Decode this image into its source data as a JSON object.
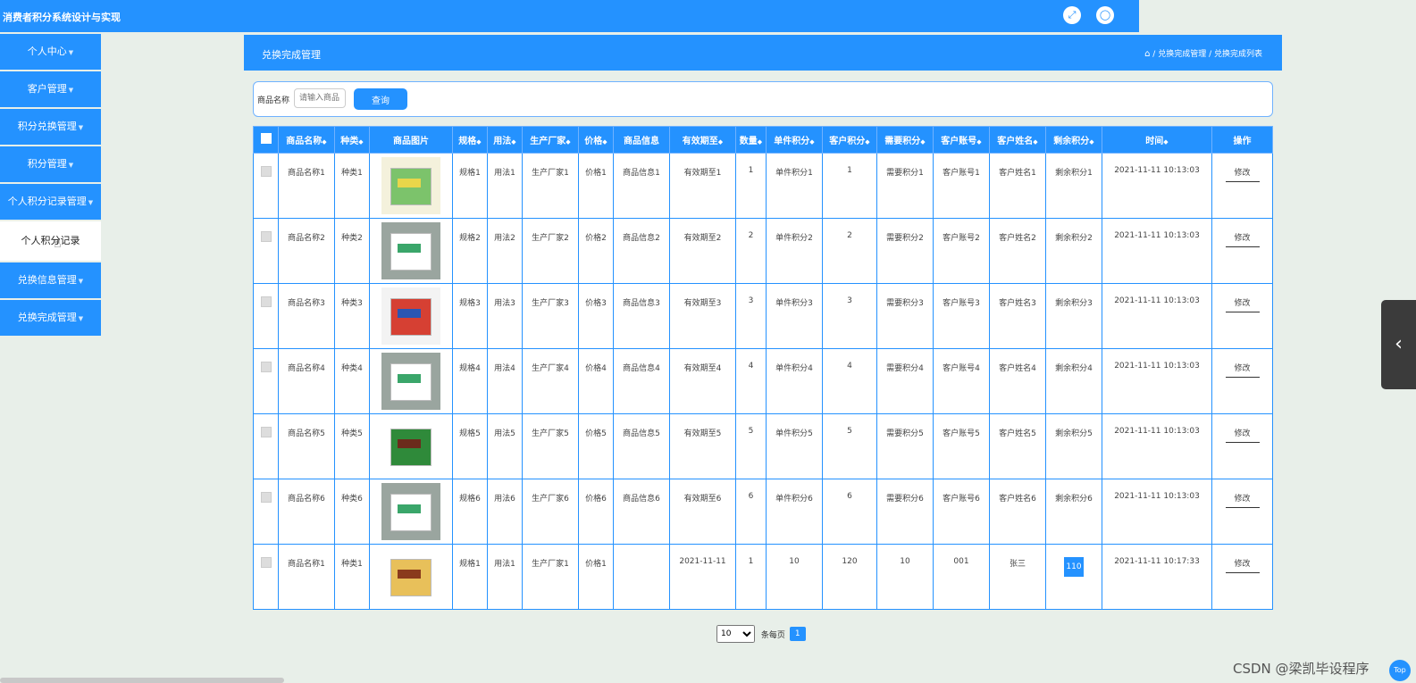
{
  "app": {
    "title": "消费者积分系统设计与实现"
  },
  "topbar": {
    "fullscreen_icon": "expand-icon",
    "user_icon": "user-icon"
  },
  "sidebar": {
    "items": [
      {
        "label": "个人中心",
        "active": false
      },
      {
        "label": "客户管理",
        "active": false
      },
      {
        "label": "积分兑换管理",
        "active": false
      },
      {
        "label": "积分管理",
        "active": false
      },
      {
        "label": "个人积分记录管理",
        "active": false
      },
      {
        "label": "个人积分记录",
        "active": true,
        "sub": true
      },
      {
        "label": "兑换信息管理",
        "active": false
      },
      {
        "label": "兑换完成管理",
        "active": false
      }
    ]
  },
  "header": {
    "title": "兑换完成管理",
    "breadcrumb": [
      "兑换完成管理",
      "兑换完成列表"
    ]
  },
  "search": {
    "label": "商品名称",
    "placeholder": "请输入商品",
    "button": "查询"
  },
  "table": {
    "columns": [
      "商品名称",
      "种类",
      "商品图片",
      "规格",
      "用法",
      "生产厂家",
      "价格",
      "商品信息",
      "有效期至",
      "数量",
      "单件积分",
      "客户积分",
      "需要积分",
      "客户账号",
      "客户姓名",
      "剩余积分",
      "时间",
      "操作"
    ],
    "rows": [
      {
        "name": "商品名称1",
        "kind": "种类1",
        "spec": "规格1",
        "usage": "用法1",
        "maker": "生产厂家1",
        "price": "价格1",
        "info": "商品信息1",
        "expiry": "有效期至1",
        "qty": "1",
        "unit_points": "单件积分1",
        "cust_points": "1",
        "need_points": "需要积分1",
        "account": "客户账号1",
        "cust_name": "客户姓名1",
        "remain": "剩余积分1",
        "time": "2021-11-11 10:13:03",
        "action": "修改"
      },
      {
        "name": "商品名称2",
        "kind": "种类2",
        "spec": "规格2",
        "usage": "用法2",
        "maker": "生产厂家2",
        "price": "价格2",
        "info": "商品信息2",
        "expiry": "有效期至2",
        "qty": "2",
        "unit_points": "单件积分2",
        "cust_points": "2",
        "need_points": "需要积分2",
        "account": "客户账号2",
        "cust_name": "客户姓名2",
        "remain": "剩余积分2",
        "time": "2021-11-11 10:13:03",
        "action": "修改"
      },
      {
        "name": "商品名称3",
        "kind": "种类3",
        "spec": "规格3",
        "usage": "用法3",
        "maker": "生产厂家3",
        "price": "价格3",
        "info": "商品信息3",
        "expiry": "有效期至3",
        "qty": "3",
        "unit_points": "单件积分3",
        "cust_points": "3",
        "need_points": "需要积分3",
        "account": "客户账号3",
        "cust_name": "客户姓名3",
        "remain": "剩余积分3",
        "time": "2021-11-11 10:13:03",
        "action": "修改"
      },
      {
        "name": "商品名称4",
        "kind": "种类4",
        "spec": "规格4",
        "usage": "用法4",
        "maker": "生产厂家4",
        "price": "价格4",
        "info": "商品信息4",
        "expiry": "有效期至4",
        "qty": "4",
        "unit_points": "单件积分4",
        "cust_points": "4",
        "need_points": "需要积分4",
        "account": "客户账号4",
        "cust_name": "客户姓名4",
        "remain": "剩余积分4",
        "time": "2021-11-11 10:13:03",
        "action": "修改"
      },
      {
        "name": "商品名称5",
        "kind": "种类5",
        "spec": "规格5",
        "usage": "用法5",
        "maker": "生产厂家5",
        "price": "价格5",
        "info": "商品信息5",
        "expiry": "有效期至5",
        "qty": "5",
        "unit_points": "单件积分5",
        "cust_points": "5",
        "need_points": "需要积分5",
        "account": "客户账号5",
        "cust_name": "客户姓名5",
        "remain": "剩余积分5",
        "time": "2021-11-11 10:13:03",
        "action": "修改"
      },
      {
        "name": "商品名称6",
        "kind": "种类6",
        "spec": "规格6",
        "usage": "用法6",
        "maker": "生产厂家6",
        "price": "价格6",
        "info": "商品信息6",
        "expiry": "有效期至6",
        "qty": "6",
        "unit_points": "单件积分6",
        "cust_points": "6",
        "need_points": "需要积分6",
        "account": "客户账号6",
        "cust_name": "客户姓名6",
        "remain": "剩余积分6",
        "time": "2021-11-11 10:13:03",
        "action": "修改"
      },
      {
        "name": "商品名称1",
        "kind": "种类1",
        "spec": "规格1",
        "usage": "用法1",
        "maker": "生产厂家1",
        "price": "价格1",
        "info": "",
        "expiry": "2021-11-11",
        "qty": "1",
        "unit_points": "10",
        "cust_points": "120",
        "need_points": "10",
        "account": "001",
        "cust_name": "张三",
        "remain": "110",
        "time": "2021-11-11 10:17:33",
        "action": "修改"
      }
    ]
  },
  "pager": {
    "page_size": "10",
    "page_size_label": "条每页",
    "current_page": "1"
  },
  "watermark": "CSDN @梁凯毕设程序",
  "top_button": "Top"
}
